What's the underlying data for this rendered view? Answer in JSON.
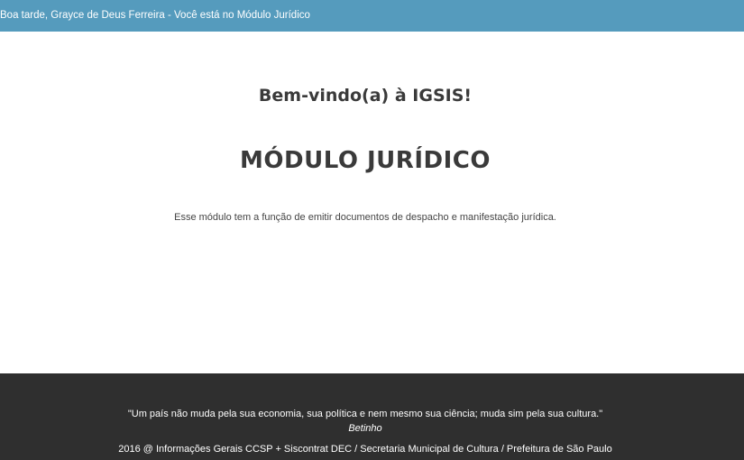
{
  "header": {
    "greeting": "Boa tarde, Grayce de Deus Ferreira - Você está no Módulo Jurídico",
    "background_color": "#559bbd"
  },
  "main": {
    "welcome": "Bem-vindo(a) à IGSIS!",
    "module_title": "MÓDULO JURÍDICO",
    "description": "Esse módulo tem a função de emitir documentos de despacho e manifestação jurídica."
  },
  "footer": {
    "quote": "\"Um país não muda pela sua economia, sua política e nem mesmo sua ciência; muda sim pela sua cultura.\"",
    "author": "Betinho",
    "credits": "2016 @ Informações Gerais CCSP + Siscontrat DEC / Secretaria Municipal de Cultura / Prefeitura de São Paulo",
    "background_color": "#2f2f2f"
  }
}
